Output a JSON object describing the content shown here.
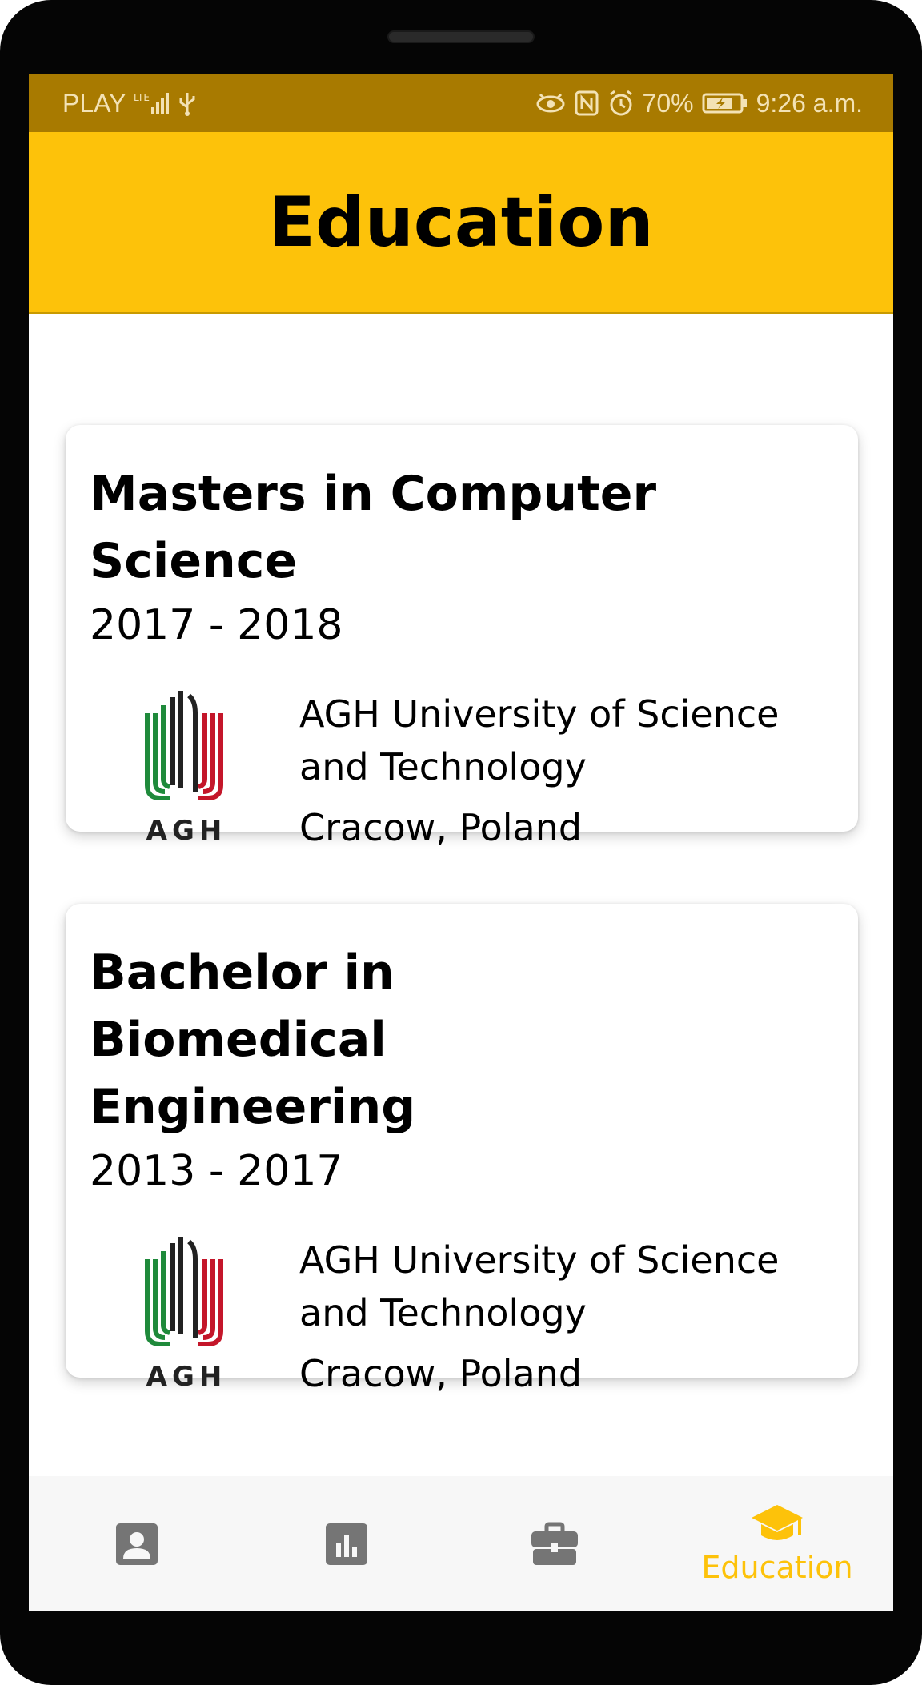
{
  "status_bar": {
    "carrier": "PLAY",
    "network": "LTE",
    "battery": "70%",
    "time": "9:26 a.m."
  },
  "app_bar": {
    "title": "Education"
  },
  "education": [
    {
      "degree": "Masters in Computer Science",
      "years": "2017 - 2018",
      "institution": "AGH University of Science and Technology",
      "location": "Cracow, Poland",
      "logo_text": "AGH"
    },
    {
      "degree": "Bachelor in Biomedical Engineering",
      "years": "2013 - 2017",
      "institution": "AGH University of Science and Technology",
      "location": "Cracow, Poland",
      "logo_text": "AGH"
    }
  ],
  "bottom_nav": {
    "items": [
      {
        "icon": "person-icon",
        "label": ""
      },
      {
        "icon": "bar-chart-icon",
        "label": ""
      },
      {
        "icon": "briefcase-icon",
        "label": ""
      },
      {
        "icon": "graduation-cap-icon",
        "label": "Education"
      }
    ],
    "active_color": "#fdc20a",
    "inactive_color": "#757575"
  },
  "colors": {
    "accent": "#fdc20a",
    "status_bar": "#a87a00"
  }
}
